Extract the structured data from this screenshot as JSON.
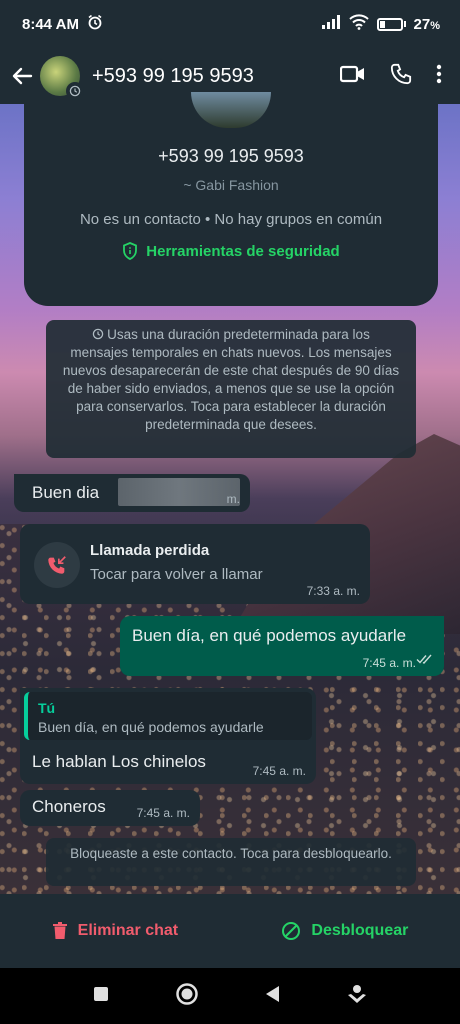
{
  "status_bar": {
    "time": "8:44 AM",
    "battery": "27",
    "battery_suffix": "%",
    "battery_level": 0.27
  },
  "header": {
    "contact_number": "+593 99 195 9593"
  },
  "contact_card": {
    "number": "+593 99 195 9593",
    "alias": "~ Gabi Fashion",
    "info": "No es un contacto • No hay grupos en común",
    "security_label": "Herramientas de seguridad"
  },
  "disappearing_notice": "Usas una duración predeterminada para los mensajes temporales en chats nuevos. Los mensajes nuevos desaparecerán de este chat después de 90 días de haber sido enviados, a menos que se use la opción para conservarlos. Toca para establecer la duración predeterminada que desees.",
  "messages": [
    {
      "text": "Buen dia",
      "time": "m."
    },
    {
      "title": "Llamada perdida",
      "subtitle": "Tocar para volver a llamar",
      "time": "7:33 a. m."
    },
    {
      "text": "Buen día, en qué podemos ayudarle",
      "time": "7:45 a. m."
    },
    {
      "quote_author": "Tú",
      "quote_text": "Buen día, en qué podemos ayudarle",
      "text": "Le hablan Los chinelos",
      "time": "7:45 a. m."
    },
    {
      "text": "Choneros",
      "time": "7:45 a. m."
    }
  ],
  "blocked_notice": "Bloqueaste a este contacto. Toca para desbloquearlo.",
  "actions": {
    "delete_label": "Eliminar chat",
    "unblock_label": "Desbloquear"
  },
  "colors": {
    "accent": "#25d366",
    "danger": "#f15c6d",
    "outgoing": "#005c4b",
    "panel": "#1f2c34"
  }
}
